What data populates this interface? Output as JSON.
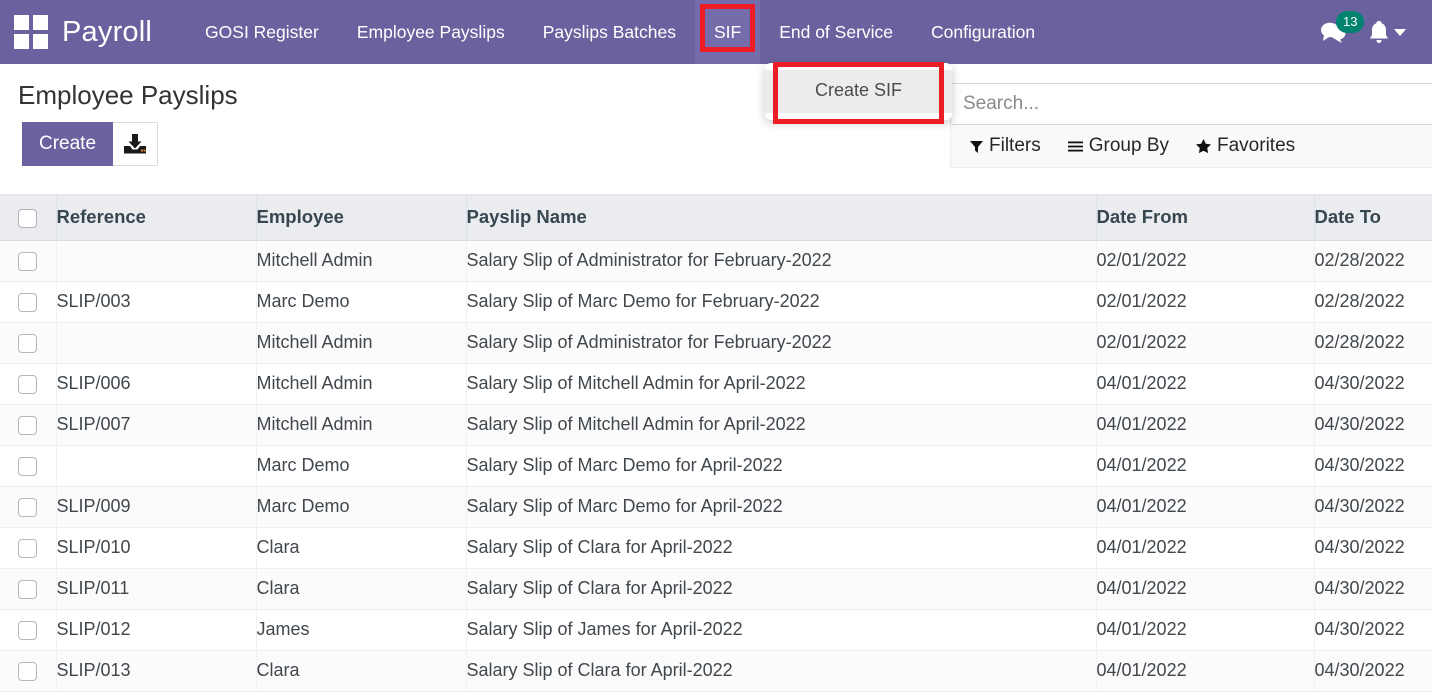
{
  "navbar": {
    "apps_icon": "grid-apps-icon",
    "brand": "Payroll",
    "menus": [
      {
        "label": "GOSI Register",
        "active": false,
        "annotated": false
      },
      {
        "label": "Employee Payslips",
        "active": false,
        "annotated": false
      },
      {
        "label": "Payslips Batches",
        "active": false,
        "annotated": false
      },
      {
        "label": "SIF",
        "active": true,
        "annotated": true
      },
      {
        "label": "End of Service",
        "active": false,
        "annotated": false
      },
      {
        "label": "Configuration",
        "active": false,
        "annotated": false
      }
    ],
    "messages_icon": "chat-bubbles-icon",
    "messages_count": "13",
    "activities_icon": "bell-icon",
    "user_menu_icon": "chevron-down-icon",
    "badge_color": "#00836f",
    "bg_color": "#6a629e",
    "active_bg_color": "#756dab",
    "annotation_color": "#ee1c25"
  },
  "sif_dropdown": {
    "open": true,
    "items": [
      {
        "label": "Create SIF",
        "highlighted": true
      }
    ]
  },
  "control_panel": {
    "title": "Employee Payslips",
    "create_label": "Create",
    "import_icon": "import-download-icon",
    "search": {
      "placeholder": "Search...",
      "value": ""
    },
    "filters": [
      {
        "label": "Filters",
        "icon": "funnel-icon"
      },
      {
        "label": "Group By",
        "icon": "hamburger-icon"
      },
      {
        "label": "Favorites",
        "icon": "star-icon"
      }
    ]
  },
  "list_view": {
    "select_all_checkbox": false,
    "columns": [
      "Reference",
      "Employee",
      "Payslip Name",
      "Date From",
      "Date To"
    ],
    "rows": [
      {
        "reference": "",
        "employee": "Mitchell Admin",
        "payslip_name": "Salary Slip of Administrator for February-2022",
        "date_from": "02/01/2022",
        "date_to": "02/28/2022"
      },
      {
        "reference": "SLIP/003",
        "employee": "Marc Demo",
        "payslip_name": "Salary Slip of Marc Demo for February-2022",
        "date_from": "02/01/2022",
        "date_to": "02/28/2022"
      },
      {
        "reference": "",
        "employee": "Mitchell Admin",
        "payslip_name": "Salary Slip of Administrator for February-2022",
        "date_from": "02/01/2022",
        "date_to": "02/28/2022"
      },
      {
        "reference": "SLIP/006",
        "employee": "Mitchell Admin",
        "payslip_name": "Salary Slip of Mitchell Admin for April-2022",
        "date_from": "04/01/2022",
        "date_to": "04/30/2022"
      },
      {
        "reference": "SLIP/007",
        "employee": "Mitchell Admin",
        "payslip_name": "Salary Slip of Mitchell Admin for April-2022",
        "date_from": "04/01/2022",
        "date_to": "04/30/2022"
      },
      {
        "reference": "",
        "employee": "Marc Demo",
        "payslip_name": "Salary Slip of Marc Demo for April-2022",
        "date_from": "04/01/2022",
        "date_to": "04/30/2022"
      },
      {
        "reference": "SLIP/009",
        "employee": "Marc Demo",
        "payslip_name": "Salary Slip of Marc Demo for April-2022",
        "date_from": "04/01/2022",
        "date_to": "04/30/2022"
      },
      {
        "reference": "SLIP/010",
        "employee": "Clara",
        "payslip_name": "Salary Slip of Clara for April-2022",
        "date_from": "04/01/2022",
        "date_to": "04/30/2022"
      },
      {
        "reference": "SLIP/011",
        "employee": "Clara",
        "payslip_name": "Salary Slip of Clara for April-2022",
        "date_from": "04/01/2022",
        "date_to": "04/30/2022"
      },
      {
        "reference": "SLIP/012",
        "employee": "James",
        "payslip_name": "Salary Slip of James for April-2022",
        "date_from": "04/01/2022",
        "date_to": "04/30/2022"
      },
      {
        "reference": "SLIP/013",
        "employee": "Clara",
        "payslip_name": "Salary Slip of Clara for April-2022",
        "date_from": "04/01/2022",
        "date_to": "04/30/2022"
      }
    ]
  }
}
